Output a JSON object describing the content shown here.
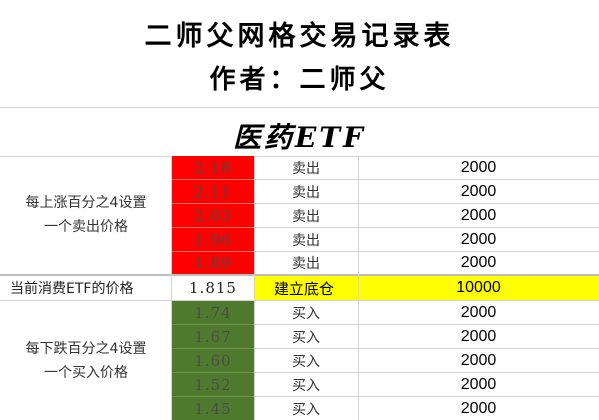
{
  "title": "二师父网格交易记录表",
  "author": "作者：二师父",
  "fund": "医药ETF",
  "sell_section": {
    "label_line1": "每上涨百分之4设置",
    "label_line2": "一个卖出价格",
    "color": "#ff0000",
    "rows": [
      {
        "price": "2.18",
        "action": "卖出",
        "qty": "2000"
      },
      {
        "price": "2.11",
        "action": "卖出",
        "qty": "2000"
      },
      {
        "price": "2.03",
        "action": "卖出",
        "qty": "2000"
      },
      {
        "price": "1.96",
        "action": "卖出",
        "qty": "2000"
      },
      {
        "price": "1.89",
        "action": "卖出",
        "qty": "2000"
      }
    ]
  },
  "current": {
    "label": "当前消费ETF的价格",
    "price": "1.815",
    "action": "建立底仓",
    "qty": "10000",
    "color": "#ffff00"
  },
  "buy_section": {
    "label_line1": "每下跌百分之4设置",
    "label_line2": "一个买入价格",
    "color": "#4f7a2e",
    "rows": [
      {
        "price": "1.74",
        "action": "买入",
        "qty": "2000"
      },
      {
        "price": "1.67",
        "action": "买入",
        "qty": "2000"
      },
      {
        "price": "1.60",
        "action": "买入",
        "qty": "2000"
      },
      {
        "price": "1.52",
        "action": "买入",
        "qty": "2000"
      },
      {
        "price": "1.45",
        "action": "买入",
        "qty": "2000"
      }
    ]
  }
}
